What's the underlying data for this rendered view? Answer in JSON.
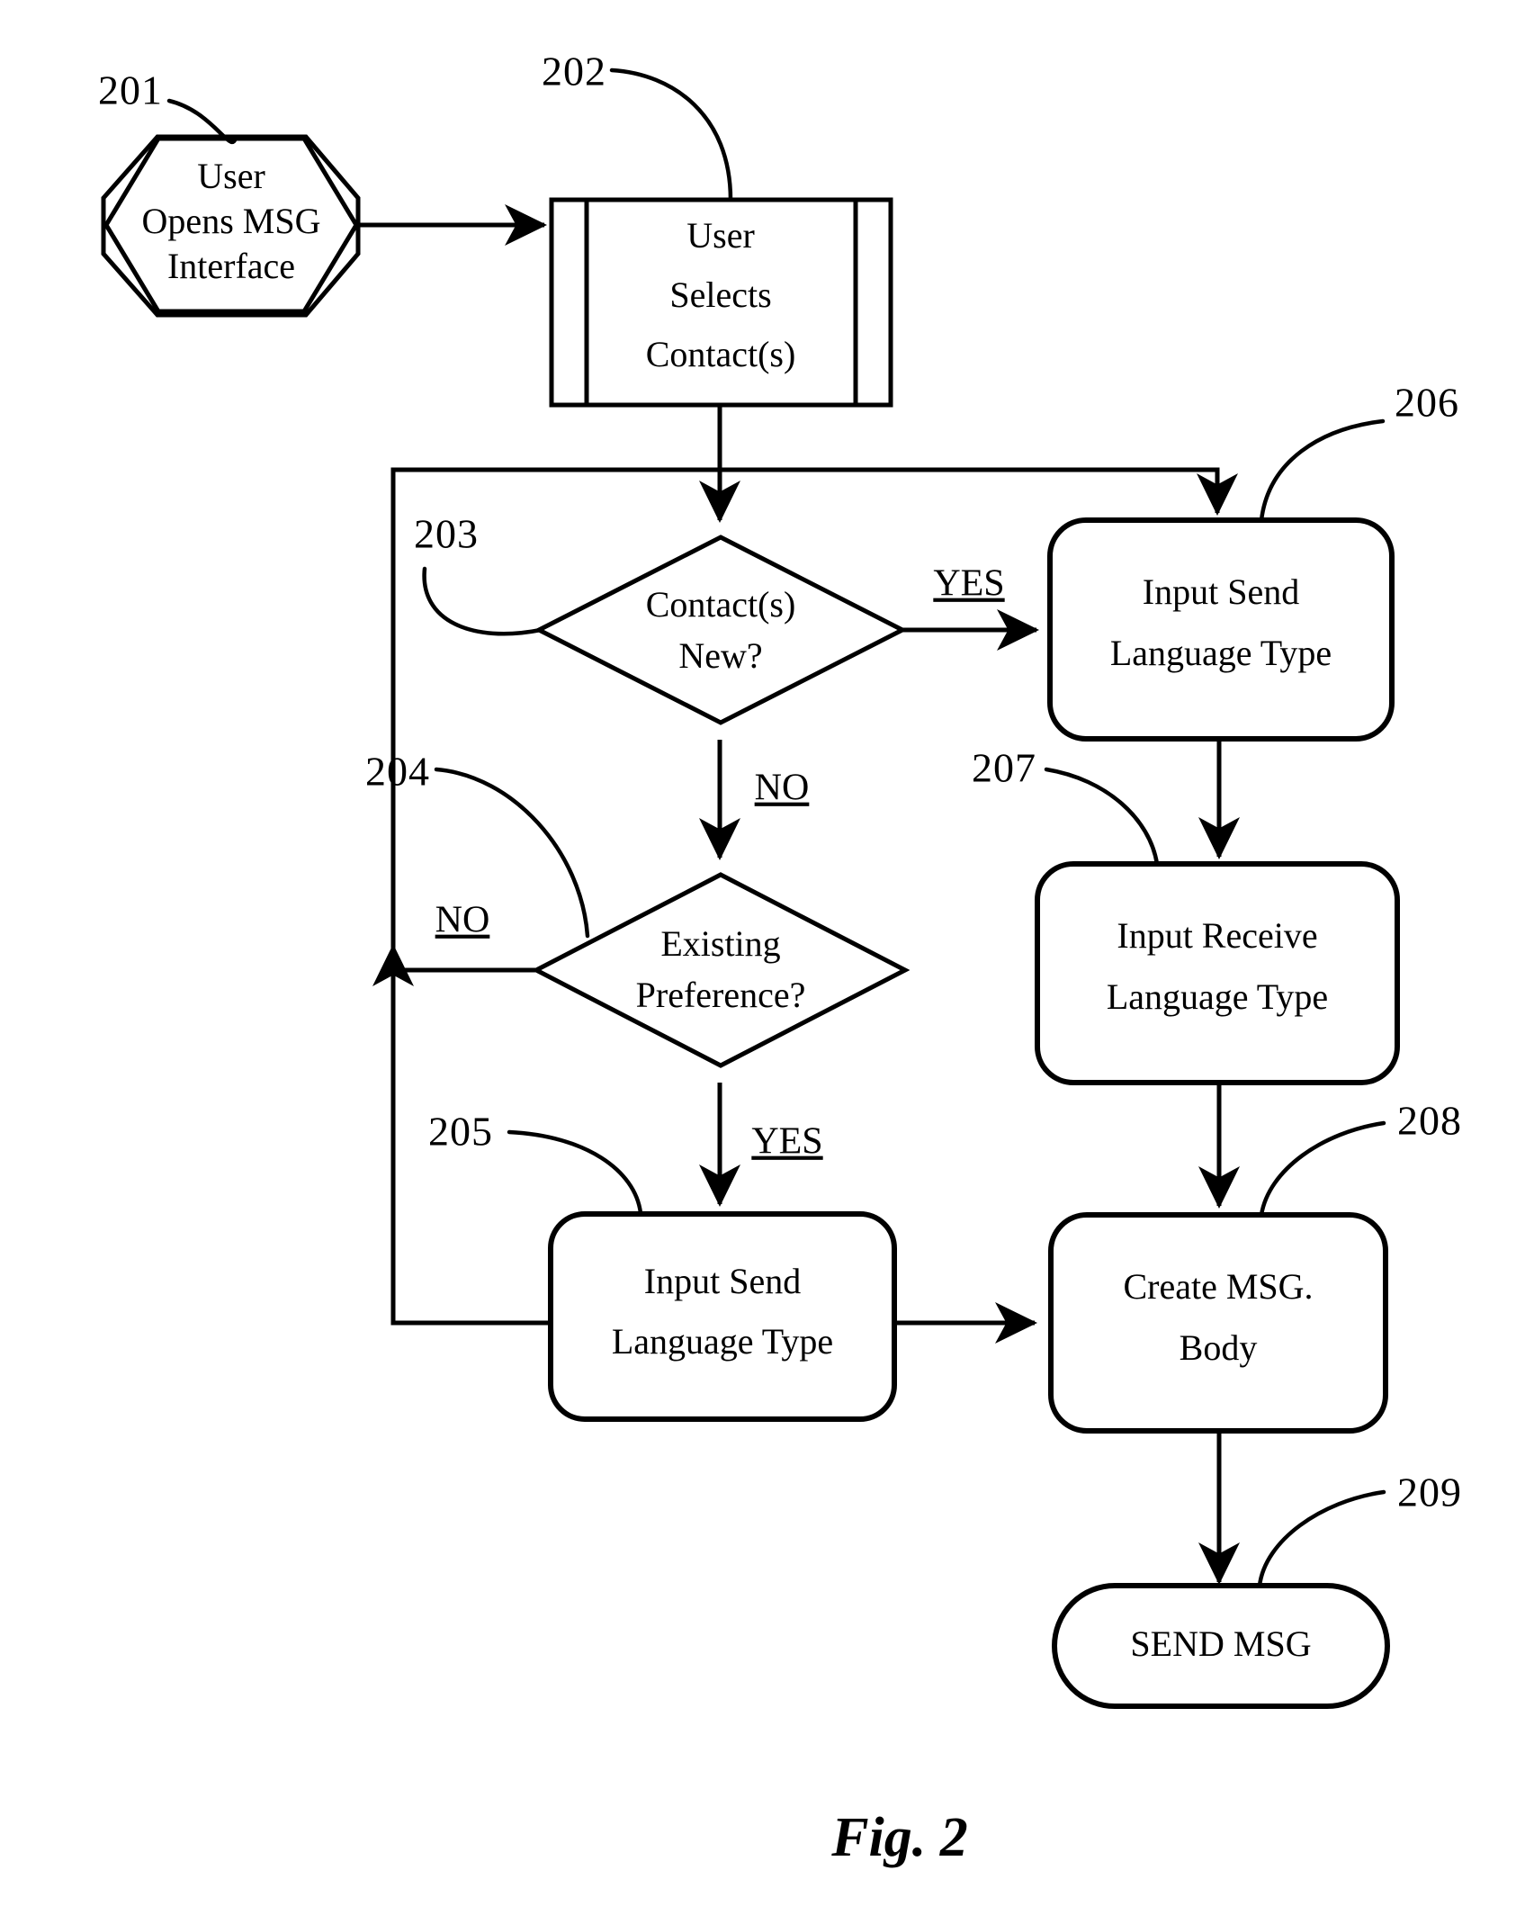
{
  "figure": {
    "caption": "Fig. 2",
    "title": "Messaging language preference flowchart"
  },
  "nodes": [
    {
      "id": "201",
      "ref": "201",
      "shape": "hexagon",
      "lines": [
        "User",
        "Opens MSG",
        "Interface"
      ],
      "text": "User Opens MSG Interface"
    },
    {
      "id": "202",
      "ref": "202",
      "shape": "predefined-process",
      "lines": [
        "User",
        "Selects",
        "Contact(s)"
      ],
      "text": "User Selects Contact(s)"
    },
    {
      "id": "203",
      "ref": "203",
      "shape": "diamond",
      "lines": [
        "Contact(s)",
        "New?"
      ],
      "text": "Contact(s) New?"
    },
    {
      "id": "204",
      "ref": "204",
      "shape": "diamond",
      "lines": [
        "Existing",
        "Preference?"
      ],
      "text": "Existing Preference?"
    },
    {
      "id": "205",
      "ref": "205",
      "shape": "rounded-rect",
      "lines": [
        "Input Send",
        "Language Type"
      ],
      "text": "Input Send Language Type"
    },
    {
      "id": "206",
      "ref": "206",
      "shape": "rounded-rect",
      "lines": [
        "Input Send",
        "Language Type"
      ],
      "text": "Input Send Language Type"
    },
    {
      "id": "207",
      "ref": "207",
      "shape": "rounded-rect",
      "lines": [
        "Input Receive",
        "Language Type"
      ],
      "text": "Input Receive Language Type"
    },
    {
      "id": "208",
      "ref": "208",
      "shape": "rounded-rect",
      "lines": [
        "Create MSG.",
        "Body"
      ],
      "text": "Create MSG. Body"
    },
    {
      "id": "209",
      "ref": "209",
      "shape": "stadium",
      "lines": [
        "SEND MSG"
      ],
      "text": "SEND MSG"
    }
  ],
  "edge_labels": {
    "yes_203": "YES",
    "no_203": "NO",
    "no_204": "NO",
    "yes_204": "YES"
  },
  "colors": {
    "ink": "#000000",
    "paper": "#ffffff"
  }
}
